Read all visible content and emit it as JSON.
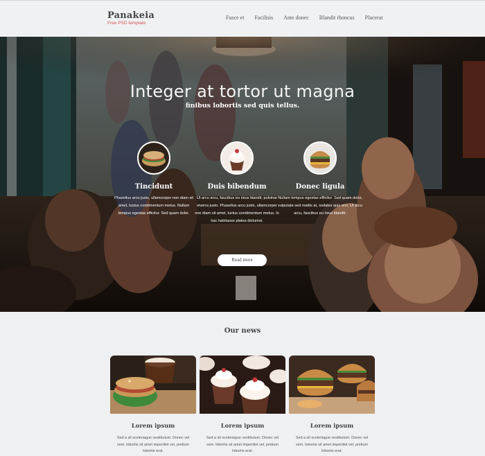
{
  "header": {
    "logo_title": "Panakeia",
    "logo_subtitle": "Free PSD template",
    "nav": [
      "Fusce et",
      "Facilisis",
      "Ante donec",
      "Blandit rhoncus",
      "Placerat"
    ]
  },
  "hero": {
    "title": "Integer at tortor ut magna",
    "subtitle": "finibus lobortis sed quis tellus.",
    "features": [
      {
        "title": "Tincidunt",
        "text": "Phasellus arcu justo, ullamcorper non diam sit amet, luctus condimentum metus. Nullam tempus egestas efficitur. Sed quam dolor.",
        "icon": "sandwich-icon"
      },
      {
        "title": "Duis bibendum",
        "text": "Ut arcu arcu, faucibus eu risus blandit, pulvinar viverra justo. Phasellus arcu justo, ullamcorper non diam sit amet, luctus condimentum metus. In hac habitasse platea dictumst.",
        "icon": "cupcake-icon"
      },
      {
        "title": "Donec ligula",
        "text": "Nullam tempus egestas efficitur. Sed quam dolor, vulputate sed mattis at, sodales quis orci. Ut arcu arcu, faucibus eu risus blandit.",
        "icon": "burger-icon"
      }
    ],
    "read_more": "Read more"
  },
  "news": {
    "title": "Our news",
    "cards": [
      {
        "title": "Lorem ipsum",
        "text": "Sed a sit sceleriague vestibulum. Donec vel sem. lobortis sit amet imperdiet vel, pretium lobortis erat.",
        "image": "sandwich-coffee-photo"
      },
      {
        "title": "Lorem ipsum",
        "text": "Sed a sit sceleriague vestibulum. Donec vel sem. lobortis sit amet imperdiet vel, pretium lobortis erat.",
        "image": "cupcakes-photo"
      },
      {
        "title": "Lorem ipsum",
        "text": "Sed a sit sceleriague vestibulum. Donec vel sem. lobortis sit amet imperdiet vel, pretium lobortis erat.",
        "image": "burgers-photo"
      }
    ]
  },
  "colors": {
    "accent": "#d9534f",
    "page_bg": "#eef0f2",
    "hero_text": "#ffffff"
  }
}
